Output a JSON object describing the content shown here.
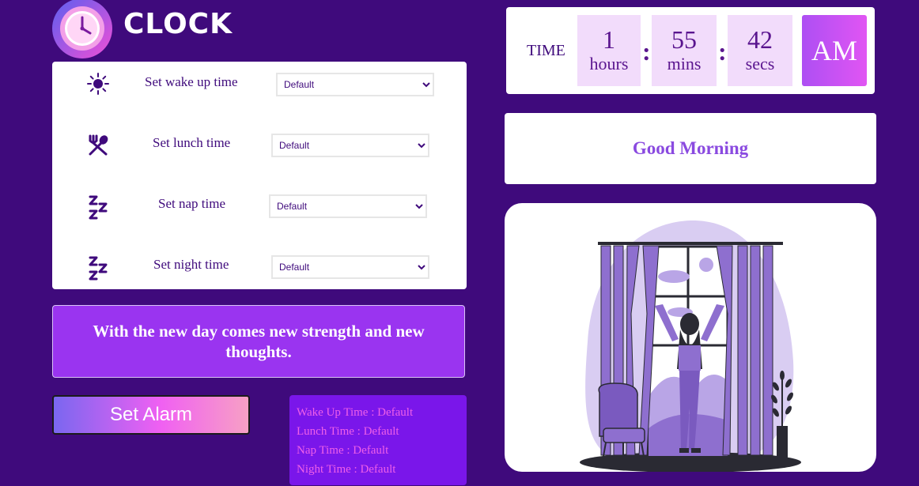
{
  "brand": {
    "title": "CLOCK"
  },
  "settings": {
    "rows": [
      {
        "label": "Set wake up time",
        "icon": "sun-icon",
        "selected": "Default"
      },
      {
        "label": "Set lunch time",
        "icon": "fork-spoon-icon",
        "selected": "Default"
      },
      {
        "label": "Set nap time",
        "icon": "zzz-icon",
        "selected": "Default"
      },
      {
        "label": "Set night time",
        "icon": "zzz-icon",
        "selected": "Default"
      }
    ]
  },
  "quote": "With the new day comes new strength and new thoughts.",
  "alarm": {
    "button_label": "Set Alarm"
  },
  "summary": {
    "lines": [
      "Wake Up Time : Default",
      "Lunch Time : Default",
      "Nap Time : Default",
      "Night Time : Default"
    ]
  },
  "time": {
    "label": "TIME",
    "hours": "1",
    "hours_label": "hours",
    "mins": "55",
    "mins_label": "mins",
    "secs": "42",
    "secs_label": "secs",
    "separator": ":",
    "ampm": "AM"
  },
  "greeting": "Good Morning",
  "colors": {
    "background": "#3f0a7c",
    "accent": "#9a34f0",
    "greeting": "#8a4ae0",
    "summary_text": "#ef5fe8"
  }
}
